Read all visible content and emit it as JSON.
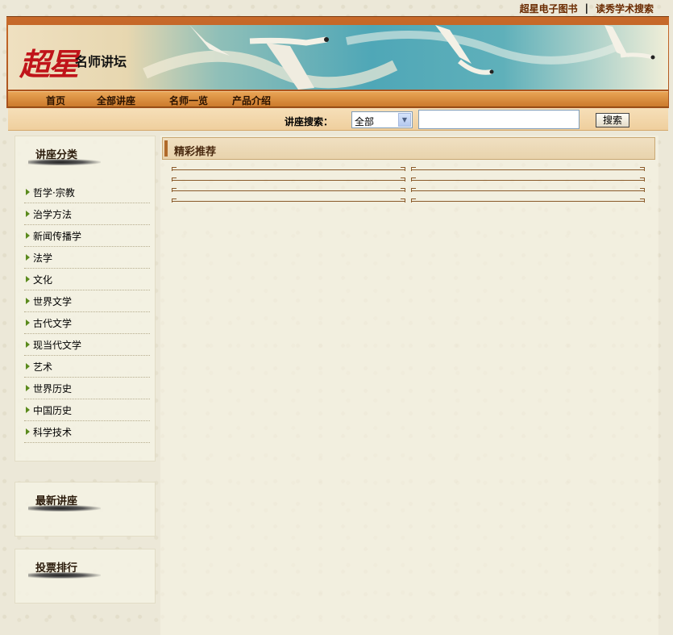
{
  "top_links": {
    "ebook": "超星电子图书",
    "separator": "|",
    "search": "读秀学术搜索"
  },
  "banner": {
    "logo_mark": "超星",
    "logo_text": "名师讲坛"
  },
  "nav": {
    "items": [
      "首页",
      "全部讲座",
      "名师一览",
      "产品介绍"
    ]
  },
  "search": {
    "label": "讲座搜索：",
    "scope_selected": "全部",
    "query_value": "",
    "button": "搜索"
  },
  "sidebar": {
    "categories_title": "讲座分类",
    "categories": [
      "哲学·宗教",
      "治学方法",
      "新闻传播学",
      "法学",
      "文化",
      "世界文学",
      "古代文学",
      "现当代文学",
      "艺术",
      "世界历史",
      "中国历史",
      "科学技术"
    ],
    "latest_title": "最新讲座",
    "vote_title": "投票排行"
  },
  "main": {
    "title": "精彩推荐"
  },
  "colors": {
    "nav_orange": "#cc7a2c",
    "accent_brown": "#6a2a00",
    "logo_red": "#c0141a"
  }
}
